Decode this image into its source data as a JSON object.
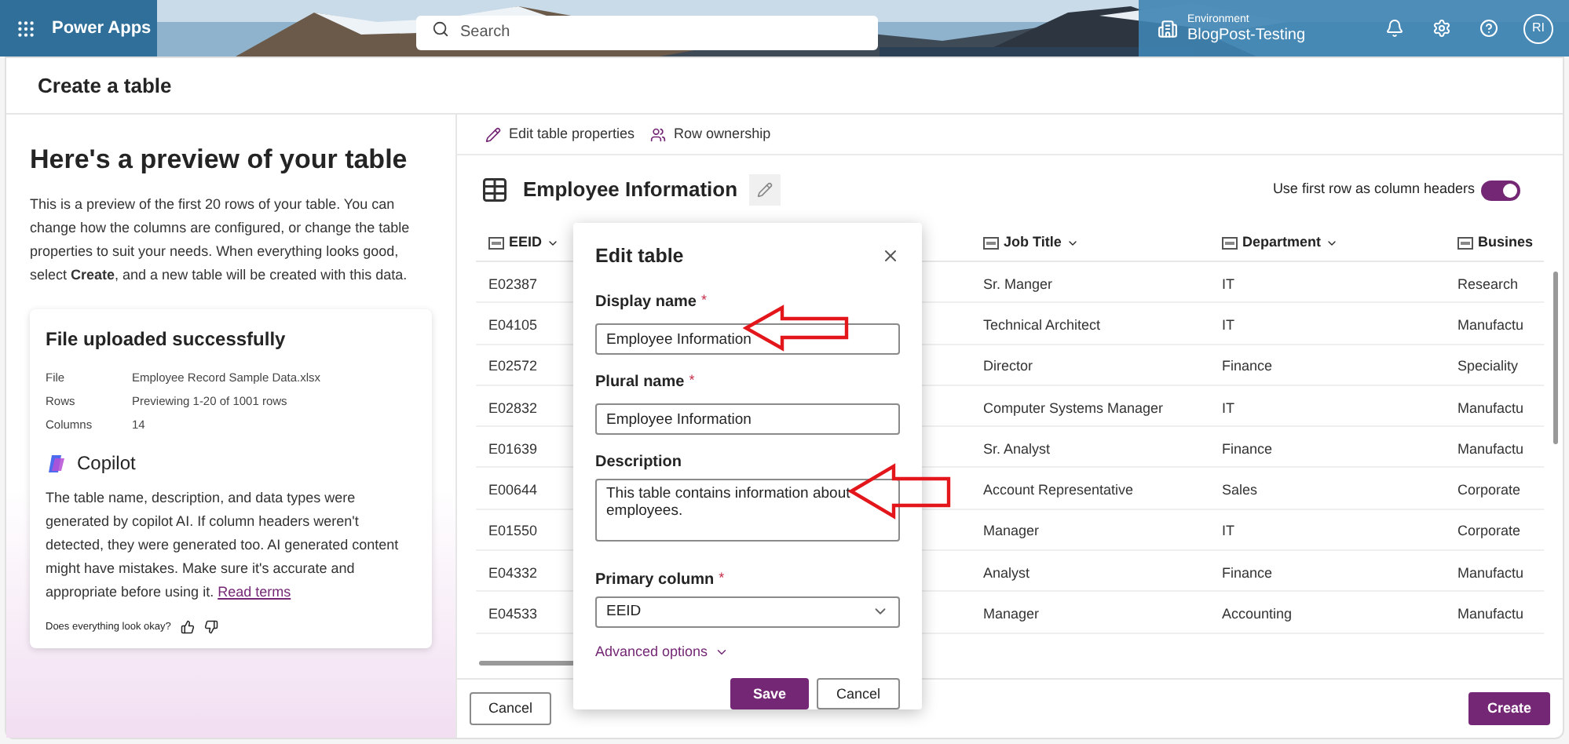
{
  "header": {
    "app_name": "Power Apps",
    "search": {
      "placeholder": "Search"
    },
    "environment": {
      "label": "Environment",
      "name": "BlogPost-Testing"
    },
    "avatar": "RI"
  },
  "page_title": "Create a table",
  "preview": {
    "heading": "Here's a preview of your table",
    "intro": "This is a preview of the first 20 rows of your table. You can change how the columns are configured, or change the table properties to suit your needs. When everything looks good, select **Create**, and a new table will be created with this data.",
    "card": {
      "title": "File uploaded successfully",
      "details": [
        {
          "label": "File",
          "value": "Employee Record Sample Data.xlsx"
        },
        {
          "label": "Rows",
          "value": "Previewing 1-20 of 1001 rows"
        },
        {
          "label": "Columns",
          "value": "14"
        }
      ],
      "copilot": {
        "title": "Copilot",
        "text": "The table name, description, and data types were generated by copilot AI. If column headers weren't detected, they were generated too. AI generated content might have mistakes. Make sure it's accurate and appropriate before using it.",
        "link": "Read terms"
      },
      "feedback": "Does everything look okay?"
    }
  },
  "toolbar": [
    {
      "kind": "edit",
      "label": "Edit table properties"
    },
    {
      "kind": "ownership",
      "label": "Row ownership"
    }
  ],
  "table": {
    "name": "Employee Information",
    "header_toggle": {
      "label": "Use first row as column headers",
      "on": true
    },
    "columns": [
      {
        "label": "EEID"
      },
      {
        "label": "Job Title"
      },
      {
        "label": "Department"
      },
      {
        "label": "Busines"
      }
    ],
    "rows": [
      [
        "E02387",
        "Sr. Manger",
        "IT",
        "Research"
      ],
      [
        "E04105",
        "Technical Architect",
        "IT",
        "Manufactu"
      ],
      [
        "E02572",
        "Director",
        "Finance",
        "Speciality"
      ],
      [
        "E02832",
        "Computer Systems Manager",
        "IT",
        "Manufactu"
      ],
      [
        "E01639",
        "Sr. Analyst",
        "Finance",
        "Manufactu"
      ],
      [
        "E00644",
        "Account Representative",
        "Sales",
        "Corporate"
      ],
      [
        "E01550",
        "Manager",
        "IT",
        "Corporate"
      ],
      [
        "E04332",
        "Analyst",
        "Finance",
        "Manufactu"
      ],
      [
        "E04533",
        "Manager",
        "Accounting",
        "Manufactu"
      ]
    ]
  },
  "dialog": {
    "title": "Edit table",
    "fields": [
      {
        "kind": "text",
        "label": "Display name",
        "required_mark": "*",
        "value": "Employee Information"
      },
      {
        "kind": "text",
        "label": "Plural name",
        "required_mark": "*",
        "value": "Employee Information"
      },
      {
        "kind": "textarea",
        "label": "Description",
        "value": "This table contains information about employees."
      },
      {
        "kind": "select",
        "label": "Primary column",
        "required_mark": "*",
        "value": "EEID"
      }
    ],
    "advanced": "Advanced options",
    "save": "Save",
    "cancel": "Cancel"
  },
  "footer": {
    "cancel": "Cancel",
    "create": "Create"
  }
}
